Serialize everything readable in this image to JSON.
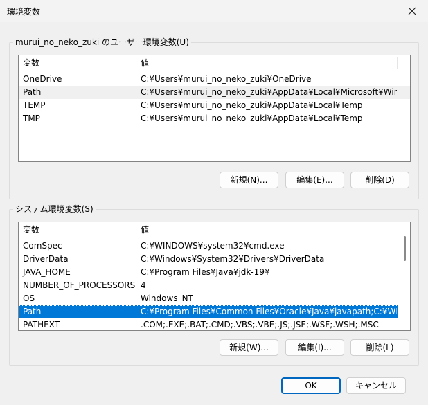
{
  "window": {
    "title": "環境変数",
    "close_label": "✕"
  },
  "user_vars": {
    "group_label": "murui_no_neko_zuki のユーザー環境変数(U)",
    "headers": {
      "name": "変数",
      "value": "値"
    },
    "rows": [
      {
        "name": "OneDrive",
        "value": "C:¥Users¥murui_no_neko_zuki¥OneDrive"
      },
      {
        "name": "Path",
        "value": "C:¥Users¥murui_no_neko_zuki¥AppData¥Local¥Microsoft¥Windows..."
      },
      {
        "name": "TEMP",
        "value": "C:¥Users¥murui_no_neko_zuki¥AppData¥Local¥Temp"
      },
      {
        "name": "TMP",
        "value": "C:¥Users¥murui_no_neko_zuki¥AppData¥Local¥Temp"
      }
    ],
    "buttons": {
      "new": "新規(N)...",
      "edit": "編集(E)...",
      "delete": "削除(D)"
    }
  },
  "system_vars": {
    "group_label": "システム環境変数(S)",
    "headers": {
      "name": "変数",
      "value": "値"
    },
    "rows": [
      {
        "name": "ComSpec",
        "value": "C:¥WINDOWS¥system32¥cmd.exe"
      },
      {
        "name": "DriverData",
        "value": "C:¥Windows¥System32¥Drivers¥DriverData"
      },
      {
        "name": "JAVA_HOME",
        "value": "C:¥Program Files¥Java¥jdk-19¥"
      },
      {
        "name": "NUMBER_OF_PROCESSORS",
        "value": "4"
      },
      {
        "name": "OS",
        "value": "Windows_NT"
      },
      {
        "name": "Path",
        "value": "C:¥Program Files¥Common Files¥Oracle¥Java¥javapath;C:¥WINDOW..."
      },
      {
        "name": "PATHEXT",
        "value": ".COM;.EXE;.BAT;.CMD;.VBS;.VBE;.JS;.JSE;.WSF;.WSH;.MSC"
      }
    ],
    "buttons": {
      "new": "新規(W)...",
      "edit": "編集(I)...",
      "delete": "削除(L)"
    }
  },
  "dialog_buttons": {
    "ok": "OK",
    "cancel": "キャンセル"
  },
  "colors": {
    "selection": "#0078d7",
    "default_button_border": "#0067c0"
  }
}
